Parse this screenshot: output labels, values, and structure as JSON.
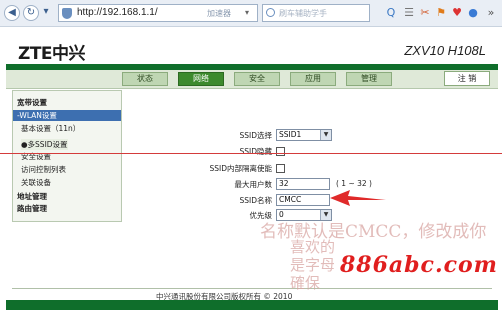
{
  "browser": {
    "url": "http://192.168.1.1/",
    "accelerator_label": "加速器",
    "search_placeholder": "刷车辅助学手"
  },
  "router": {
    "brand": "ZTE中兴",
    "model": "ZXV10 H108L",
    "tabs": [
      {
        "label": "状态"
      },
      {
        "label": "网络"
      },
      {
        "label": "安全"
      },
      {
        "label": "应用"
      },
      {
        "label": "管理"
      }
    ],
    "active_tab": "网络",
    "logout_label": "注 销"
  },
  "sidebar": {
    "items": [
      {
        "label": "宽带设置"
      },
      {
        "label": "-WLAN设置"
      },
      {
        "label": "基本设置（11n）"
      },
      {
        "label": "●多SSID设置"
      },
      {
        "label": "安全设置"
      },
      {
        "label": "访问控制列表"
      },
      {
        "label": "关联设备"
      },
      {
        "label": "地址管理"
      },
      {
        "label": "路由管理"
      }
    ]
  },
  "form": {
    "ssid_select_label": "SSID选择",
    "ssid_select_value": "SSID1",
    "ssid_hide_label": "SSID隐藏",
    "ssid_isolation_label": "SSID内部隔离使能",
    "max_users_label": "最大用户数",
    "max_users_value": "32",
    "max_users_hint": "( 1 ~ 32 )",
    "ssid_name_label": "SSID名称",
    "ssid_name_value": "CMCC",
    "priority_label": "优先级",
    "priority_value": "0"
  },
  "annotation": {
    "line1": "名称默认是CMCC，修改成你",
    "line2": "喜欢的",
    "line3": "是字母",
    "line4": "確保"
  },
  "footer": {
    "copyright": "中兴通讯股份有限公司版权所有 © 2010"
  },
  "watermark": "886abc.com",
  "colors": {
    "brand_green": "#0f6e2b",
    "active_tab": "#3d8a2e",
    "watermark": "#e01e1e"
  }
}
